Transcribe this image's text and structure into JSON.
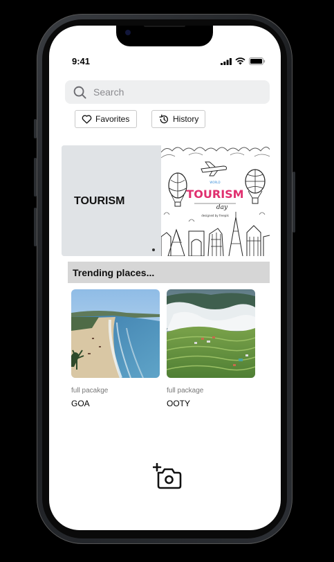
{
  "status_bar": {
    "time": "9:41",
    "icons": [
      "cellular-signal-icon",
      "wifi-icon",
      "battery-icon"
    ]
  },
  "search": {
    "placeholder": "Search",
    "icon": "search-icon"
  },
  "filters": [
    {
      "label": "Favorites",
      "icon": "heart-icon"
    },
    {
      "label": "History",
      "icon": "history-icon"
    }
  ],
  "banner": {
    "title": "TOURISM",
    "image": {
      "label_top": "WORLD",
      "label_main": "TOURISM",
      "label_script": "day",
      "credit": "designed by freepik"
    },
    "active_slide": 1
  },
  "trending": {
    "title": "Trending places...",
    "places": [
      {
        "subtitle": "full pacakge",
        "name": "GOA",
        "image": "beach-photo"
      },
      {
        "subtitle": "full package",
        "name": "OOTY",
        "image": "hills-photo"
      }
    ]
  },
  "actions": {
    "add_photo_icon": "add-camera-icon"
  },
  "colors": {
    "screen_bg": "#ffffff",
    "search_bg": "#eeeff0",
    "banner_bg": "#e0e3e6",
    "section_header_bg": "#d6d6d6",
    "poster_pink": "#e0306f"
  }
}
